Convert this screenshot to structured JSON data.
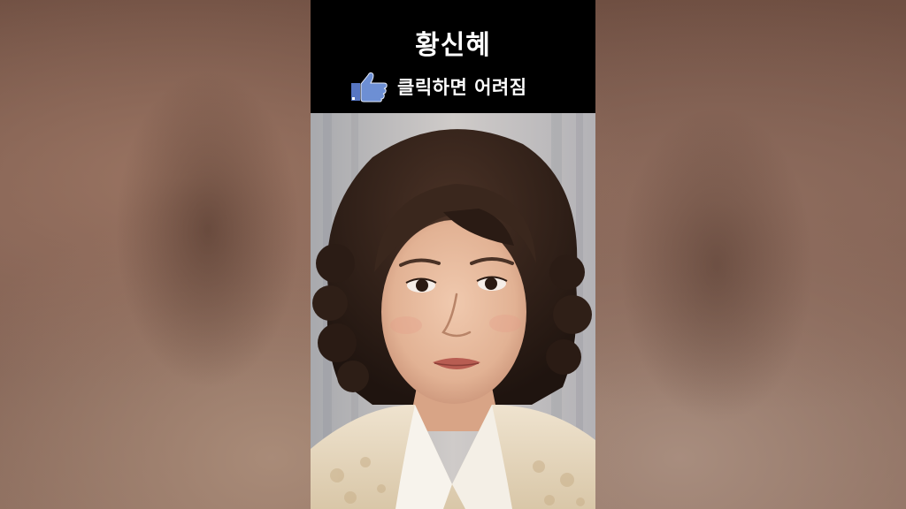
{
  "overlay": {
    "title": "황신혜",
    "cta_text": "클릭하면 어려짐"
  },
  "icons": {
    "cta_icon": "thumbs-up-icon"
  },
  "colors": {
    "caption_bar": "#000000",
    "caption_text": "#ffffff",
    "thumb_fill": "#6d8fd4"
  }
}
